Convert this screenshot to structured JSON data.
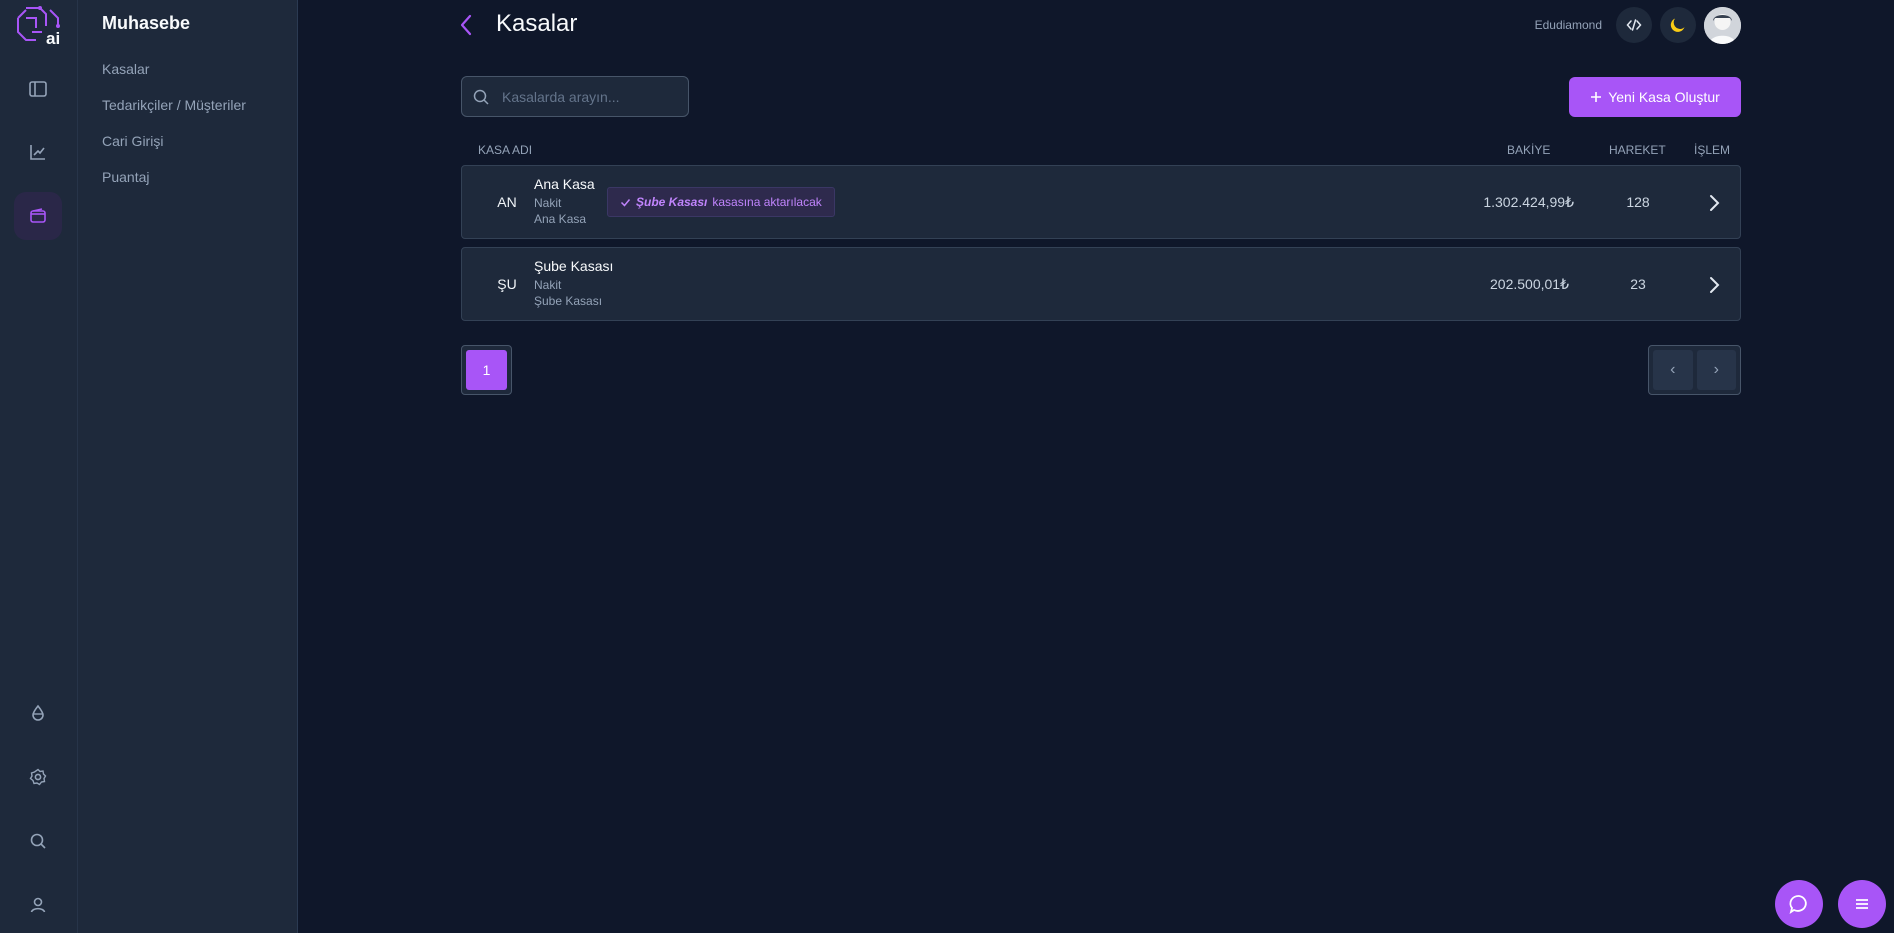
{
  "sidebar": {
    "title": "Muhasebe",
    "items": [
      {
        "label": "Kasalar"
      },
      {
        "label": "Tedarikçiler / Müşteriler"
      },
      {
        "label": "Cari Girişi"
      },
      {
        "label": "Puantaj"
      }
    ]
  },
  "rail": {
    "icons": [
      "sidebar-toggle-icon",
      "chart-icon",
      "wallet-icon",
      "droplet-icon",
      "settings-icon",
      "search-icon",
      "user-icon"
    ],
    "active": "wallet-icon"
  },
  "header": {
    "title": "Kasalar",
    "user_name": "Edudiamond"
  },
  "search": {
    "placeholder": "Kasalarda arayın..."
  },
  "toolbar": {
    "new_label": "Yeni Kasa Oluştur"
  },
  "table": {
    "columns": {
      "name": "KASA ADI",
      "balance": "BAKİYE",
      "movements": "HAREKET",
      "action": "İŞLEM"
    },
    "rows": [
      {
        "abbr": "AN",
        "name": "Ana Kasa",
        "type": "Nakit",
        "sub": "Ana Kasa",
        "badge_target": "Şube Kasası",
        "badge_text": "kasasına aktarılacak",
        "balance": "1.302.424,99₺",
        "movements": "128"
      },
      {
        "abbr": "ŞU",
        "name": "Şube Kasası",
        "type": "Nakit",
        "sub": "Şube Kasası",
        "balance": "202.500,01₺",
        "movements": "23"
      }
    ]
  },
  "pagination": {
    "current": "1",
    "prev": "‹",
    "next": "›"
  },
  "colors": {
    "accent": "#a855f7",
    "background": "#0f172a",
    "panel": "#1e293b"
  }
}
